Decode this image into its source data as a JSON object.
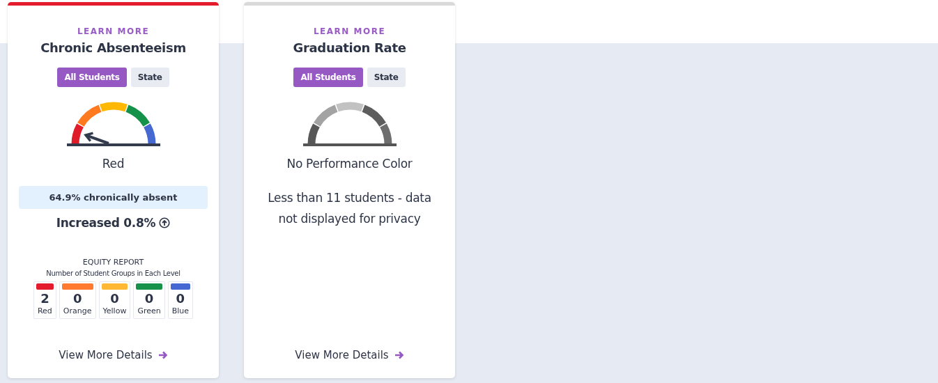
{
  "cards": [
    {
      "color": "#e31b2d",
      "learn_more": "LEARN MORE",
      "title": "Chronic Absenteeism",
      "tabs": [
        {
          "label": "All Students",
          "selected": true
        },
        {
          "label": "State",
          "selected": false
        }
      ],
      "gauge": {
        "kind": "colored"
      },
      "status": "Red",
      "stat": "64.9% chronically absent",
      "change": {
        "text": "Increased 0.8%"
      },
      "equity": {
        "title": "EQUITY REPORT",
        "subtitle": "Number of Student Groups in Each Level",
        "levels": [
          {
            "count": "2",
            "label": "Red",
            "color": "#e31b2d"
          },
          {
            "count": "0",
            "label": "Orange",
            "color": "#ff7a2e"
          },
          {
            "count": "0",
            "label": "Yellow",
            "color": "#ffb833"
          },
          {
            "count": "0",
            "label": "Green",
            "color": "#16924a"
          },
          {
            "count": "0",
            "label": "Blue",
            "color": "#4668d2"
          }
        ]
      },
      "link": "View More Details"
    },
    {
      "color": "#d9d9d9",
      "learn_more": "LEARN MORE",
      "title": "Graduation Rate",
      "tabs": [
        {
          "label": "All Students",
          "selected": true
        },
        {
          "label": "State",
          "selected": false
        }
      ],
      "gauge": {
        "kind": "gray"
      },
      "status": "No Performance Color",
      "note": "Less than 11 students - data not displayed for privacy",
      "link": "View More Details"
    }
  ]
}
